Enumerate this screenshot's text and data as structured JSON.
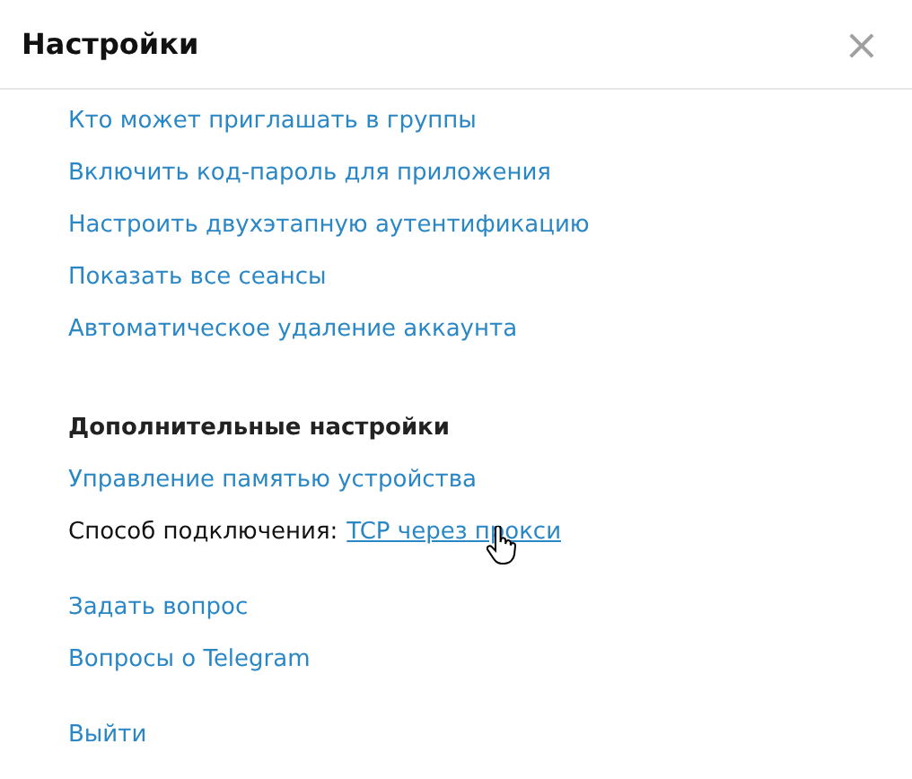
{
  "window": {
    "title": "Настройки",
    "close": "×"
  },
  "sections": [
    {
      "items": [
        {
          "kind": "link",
          "text": "Кто может приглашать в группы"
        },
        {
          "kind": "link",
          "text": "Включить код-пароль для приложения"
        },
        {
          "kind": "link",
          "text": "Настроить двухэтапную аутентификацию"
        },
        {
          "kind": "link",
          "text": "Показать все сеансы"
        },
        {
          "kind": "link",
          "text": "Автоматическое удаление аккаунта"
        }
      ]
    },
    {
      "heading": "Дополнительные настройки",
      "items": [
        {
          "kind": "link",
          "text": "Управление памятью устройства"
        },
        {
          "kind": "setting",
          "label": "Способ подключения:",
          "value": "TCP через прокси",
          "hovered": true
        }
      ]
    },
    {
      "items": [
        {
          "kind": "link",
          "text": "Задать вопрос"
        },
        {
          "kind": "link",
          "text": "Вопросы о Telegram"
        }
      ]
    },
    {
      "items": [
        {
          "kind": "link",
          "text": "Выйти"
        }
      ]
    }
  ]
}
